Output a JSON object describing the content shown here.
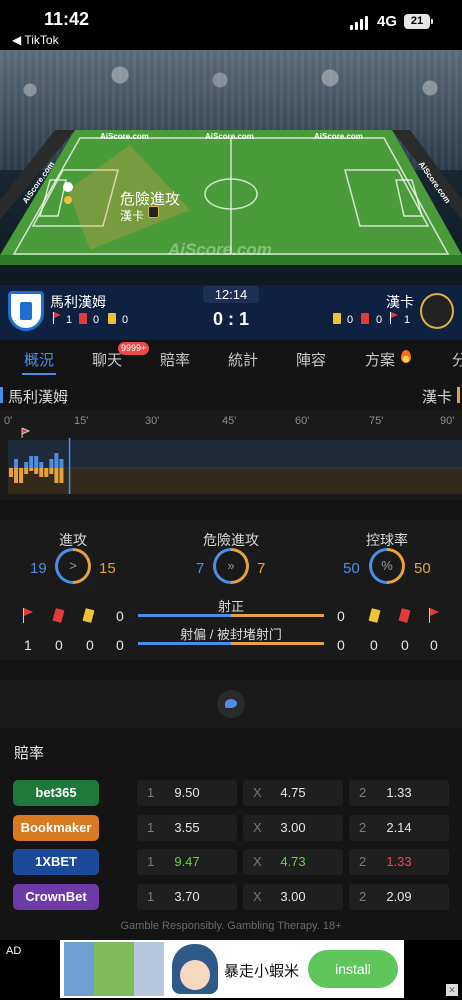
{
  "status_bar": {
    "time": "11:42",
    "back_app": "TikTok",
    "network": "4G",
    "battery": "21"
  },
  "pitch": {
    "board_labels": [
      "AiScore.com",
      "AiScore.com",
      "AiScore.com",
      "AiScore.com",
      "AiScore.com"
    ],
    "watermark": "AiScore.com",
    "event_title": "危險進攻",
    "event_team": "漢卡"
  },
  "match": {
    "home_team": "馬利漢姆",
    "away_team": "漢卡",
    "clock": "12:14",
    "score": "0 : 1",
    "home_counts": {
      "corners": "1",
      "red": "0",
      "yellow": "0"
    },
    "away_counts": {
      "yellow": "0",
      "red": "0",
      "corners": "1"
    }
  },
  "tabs": [
    {
      "label": "概況",
      "active": true
    },
    {
      "label": "聊天",
      "badge": "9999+"
    },
    {
      "label": "賠率"
    },
    {
      "label": "統計"
    },
    {
      "label": "陣容"
    },
    {
      "label": "方案"
    },
    {
      "label": "分"
    }
  ],
  "timeline": {
    "home_team": "馬利漢姆",
    "away_team": "漢卡",
    "ticks": [
      "0'",
      "15'",
      "30'",
      "45'",
      "60'",
      "75'",
      "90'"
    ],
    "current_minute": 12.2,
    "home_pressure": [
      0,
      3,
      0,
      2,
      4,
      4,
      2,
      0,
      3,
      5,
      3,
      0
    ],
    "away_pressure": [
      3,
      5,
      5,
      2,
      1,
      2,
      3,
      3,
      2,
      5,
      5,
      0
    ]
  },
  "stats": {
    "attacks": {
      "label": "進攻",
      "home": "19",
      "away": "15",
      "icon": ">"
    },
    "dangerous": {
      "label": "危險進攻",
      "home": "7",
      "away": "7",
      "icon": "»"
    },
    "possession": {
      "label": "控球率",
      "home": "50",
      "away": "50",
      "icon": "%"
    },
    "shots_on": {
      "label": "射正",
      "home": "0",
      "away": "0",
      "home_pct": 50
    },
    "shots_off": {
      "label": "射偏 / 被封堵射门",
      "home": "0",
      "away": "0",
      "home_pct": 50
    },
    "home_icons_row1": {
      "corners": "",
      "red": "",
      "yellow": ""
    },
    "home_row2": [
      "1",
      "0",
      "0"
    ],
    "away_row2": [
      "0",
      "0",
      "0"
    ]
  },
  "odds": {
    "title": "賠率",
    "rows": [
      {
        "bookie": "bet365",
        "color": "#1e7a3a",
        "h": "1",
        "hv": "9.50",
        "x": "X",
        "xv": "4.75",
        "a": "2",
        "av": "1.33"
      },
      {
        "bookie": "Bookmaker",
        "color": "#d77a22",
        "h": "1",
        "hv": "3.55",
        "x": "X",
        "xv": "3.00",
        "a": "2",
        "av": "2.14"
      },
      {
        "bookie": "1XBET",
        "color": "#1b4a9a",
        "h": "1",
        "hv": "9.47",
        "x": "X",
        "xv": "4.73",
        "a": "2",
        "av": "1.33"
      },
      {
        "bookie": "CrownBet",
        "color": "#6d3aa8",
        "h": "1",
        "hv": "3.70",
        "x": "X",
        "xv": "3.00",
        "a": "2",
        "av": "2.09"
      }
    ],
    "gamble_note": "Gamble Responsibly. Gambling Therapy. 18+"
  },
  "ad": {
    "label": "AD",
    "title": "暴走小蝦米",
    "install": "install"
  },
  "colors": {
    "home": "#4b8ee8",
    "away": "#e6a23c",
    "up": "#6ccf3a",
    "down": "#e84b4b"
  }
}
